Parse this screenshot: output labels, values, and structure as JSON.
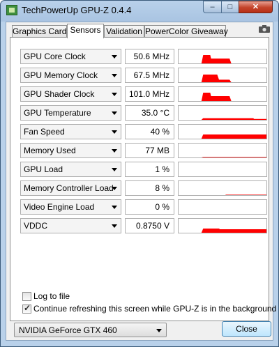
{
  "window": {
    "title": "TechPowerUp GPU-Z 0.4.4"
  },
  "tabs": [
    {
      "label": "Graphics Card",
      "active": false
    },
    {
      "label": "Sensors",
      "active": true
    },
    {
      "label": "Validation",
      "active": false
    },
    {
      "label": "PowerColor Giveaway",
      "active": false
    }
  ],
  "sensors": [
    {
      "label": "GPU Core Clock",
      "value": "50.6 MHz",
      "graph": [
        [
          0,
          0
        ],
        [
          0.26,
          0
        ],
        [
          0.28,
          0.6
        ],
        [
          0.36,
          0.6
        ],
        [
          0.37,
          0.35
        ],
        [
          0.58,
          0.35
        ],
        [
          0.6,
          0
        ]
      ]
    },
    {
      "label": "GPU Memory Clock",
      "value": "67.5 MHz",
      "graph": [
        [
          0,
          0
        ],
        [
          0.26,
          0
        ],
        [
          0.28,
          0.55
        ],
        [
          0.44,
          0.55
        ],
        [
          0.46,
          0.18
        ],
        [
          0.58,
          0.18
        ],
        [
          0.6,
          0
        ]
      ]
    },
    {
      "label": "GPU Shader Clock",
      "value": "101.0 MHz",
      "graph": [
        [
          0,
          0
        ],
        [
          0.26,
          0
        ],
        [
          0.28,
          0.6
        ],
        [
          0.36,
          0.6
        ],
        [
          0.37,
          0.35
        ],
        [
          0.58,
          0.35
        ],
        [
          0.6,
          0
        ]
      ]
    },
    {
      "label": "GPU Temperature",
      "value": "35.0 °C",
      "graph": [
        [
          0,
          0
        ],
        [
          0.26,
          0
        ],
        [
          0.28,
          0.12
        ],
        [
          0.85,
          0.12
        ],
        [
          0.86,
          0.06
        ],
        [
          1,
          0.06
        ]
      ]
    },
    {
      "label": "Fan Speed",
      "value": "40 %",
      "graph": [
        [
          0,
          0
        ],
        [
          0.26,
          0
        ],
        [
          0.28,
          0.3
        ],
        [
          1,
          0.3
        ]
      ]
    },
    {
      "label": "Memory Used",
      "value": "77 MB",
      "graph": [
        [
          0,
          0
        ],
        [
          0.26,
          0
        ],
        [
          0.28,
          0.04
        ],
        [
          1,
          0.04
        ]
      ]
    },
    {
      "label": "GPU Load",
      "value": "1 %",
      "graph": []
    },
    {
      "label": "Memory Controller Load",
      "value": "8 %",
      "graph": [
        [
          0,
          0
        ],
        [
          0.53,
          0
        ],
        [
          0.54,
          0.03
        ],
        [
          1,
          0.03
        ]
      ]
    },
    {
      "label": "Video Engine Load",
      "value": "0 %",
      "graph": []
    },
    {
      "label": "VDDC",
      "value": "0.8750 V",
      "graph": [
        [
          0,
          0
        ],
        [
          0.26,
          0
        ],
        [
          0.28,
          0.3
        ],
        [
          0.46,
          0.3
        ],
        [
          0.47,
          0.25
        ],
        [
          1,
          0.25
        ]
      ]
    }
  ],
  "options": {
    "log_to_file": {
      "label": "Log to file",
      "checked": false
    },
    "continue_refresh": {
      "label": "Continue refreshing this screen while GPU-Z is in the background",
      "checked": true
    }
  },
  "gpu_select": {
    "value": "NVIDIA GeForce GTX 460"
  },
  "close_button": {
    "label": "Close"
  },
  "colors": {
    "graph": "#ff0000",
    "titlebar": "#b9d1ea"
  }
}
